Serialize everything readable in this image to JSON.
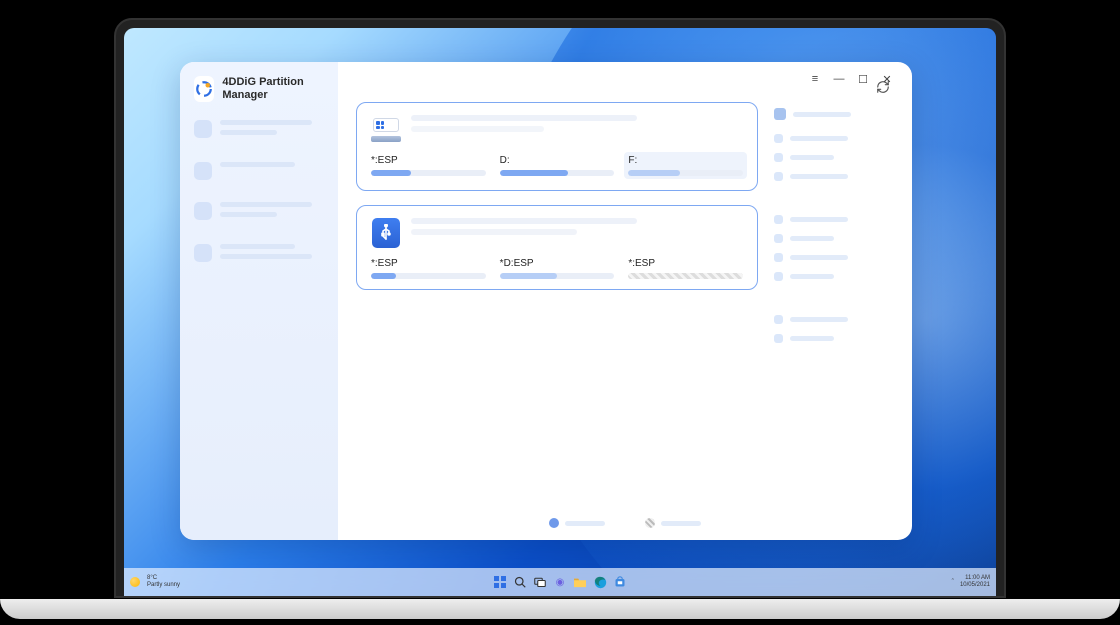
{
  "app": {
    "title": "4DDiG Partition Manager"
  },
  "window_controls": {
    "menu": "≡",
    "minimize": "—",
    "maximize": "☐",
    "close": "✕"
  },
  "disks": [
    {
      "parts": [
        {
          "label": "*:ESP",
          "fill_pct": 35
        },
        {
          "label": "D:",
          "fill_pct": 60
        },
        {
          "label": "F:",
          "fill_pct": 45,
          "selected": true
        }
      ]
    },
    {
      "parts": [
        {
          "label": "*:ESP",
          "fill_pct": 22
        },
        {
          "label": "*D:ESP",
          "fill_pct": 50
        },
        {
          "label": "*:ESP",
          "unallocated": true
        }
      ]
    }
  ],
  "taskbar": {
    "temp": "8°C",
    "weather": "Partly sunny",
    "time": "11:00 AM",
    "date": "10/05/2021",
    "chevron": "ˆ"
  }
}
